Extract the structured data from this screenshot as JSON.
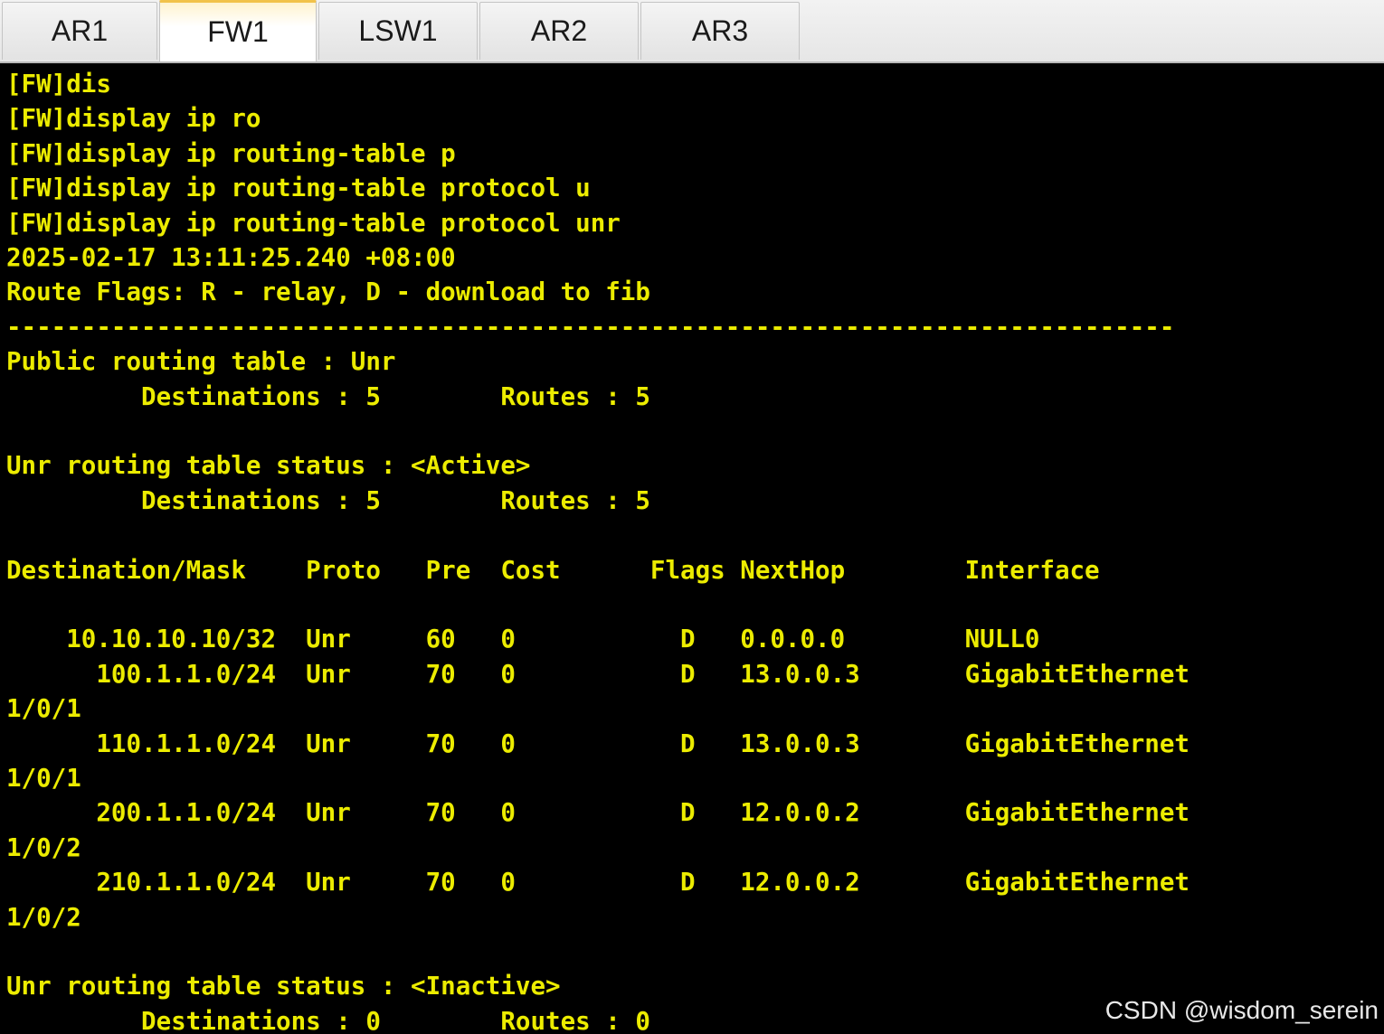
{
  "tabs": [
    {
      "label": "AR1",
      "active": false
    },
    {
      "label": "FW1",
      "active": true
    },
    {
      "label": "LSW1",
      "active": false
    },
    {
      "label": "AR2",
      "active": false
    },
    {
      "label": "AR3",
      "active": false
    }
  ],
  "terminal": {
    "text_color": "#ecec00",
    "background": "#000000",
    "lines": [
      "[FW]dis",
      "[FW]display ip ro",
      "[FW]display ip routing-table p",
      "[FW]display ip routing-table protocol u",
      "[FW]display ip routing-table protocol unr",
      "2025-02-17 13:11:25.240 +08:00",
      "Route Flags: R - relay, D - download to fib",
      "------------------------------------------------------------------------------",
      "Public routing table : Unr",
      "         Destinations : 5        Routes : 5",
      "",
      "Unr routing table status : <Active>",
      "         Destinations : 5        Routes : 5",
      "",
      "Destination/Mask    Proto   Pre  Cost      Flags NextHop        Interface",
      "",
      "    10.10.10.10/32  Unr     60   0           D   0.0.0.0        NULL0",
      "      100.1.1.0/24  Unr     70   0           D   13.0.0.3       GigabitEthernet",
      "1/0/1",
      "      110.1.1.0/24  Unr     70   0           D   13.0.0.3       GigabitEthernet",
      "1/0/1",
      "      200.1.1.0/24  Unr     70   0           D   12.0.0.2       GigabitEthernet",
      "1/0/2",
      "      210.1.1.0/24  Unr     70   0           D   12.0.0.2       GigabitEthernet",
      "1/0/2",
      "",
      "Unr routing table status : <Inactive>",
      "         Destinations : 0        Routes : 0"
    ]
  },
  "watermark": "CSDN @wisdom_serein"
}
